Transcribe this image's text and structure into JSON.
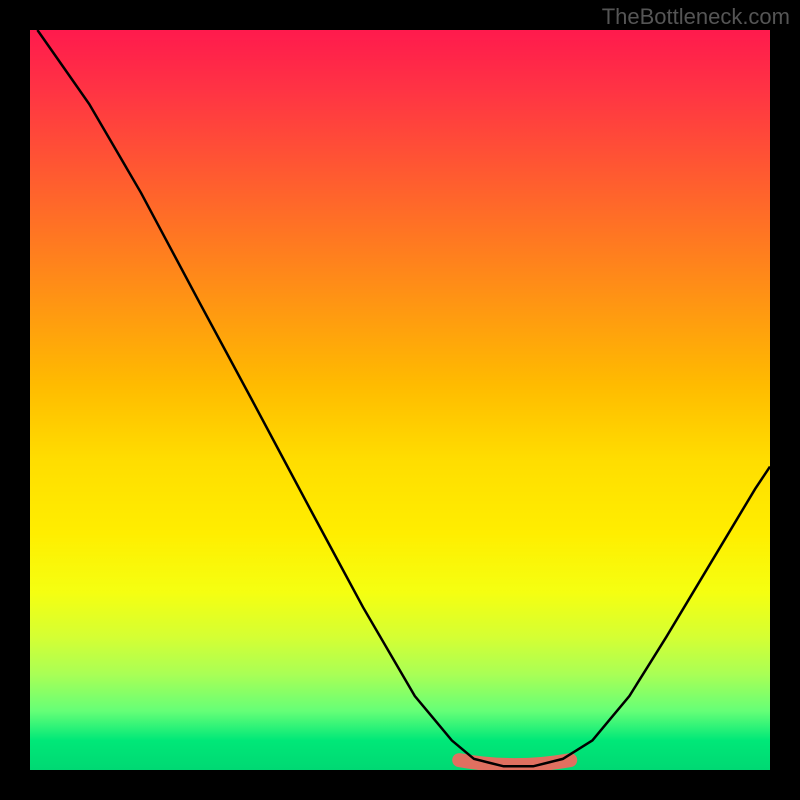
{
  "watermark": "TheBottleneck.com",
  "chart_data": {
    "type": "line",
    "title": "",
    "xlabel": "",
    "ylabel": "",
    "xlim": [
      0,
      100
    ],
    "ylim": [
      0,
      100
    ],
    "curve_points": [
      {
        "x": 1,
        "y": 100
      },
      {
        "x": 8,
        "y": 90
      },
      {
        "x": 15,
        "y": 78
      },
      {
        "x": 23,
        "y": 63
      },
      {
        "x": 30,
        "y": 50
      },
      {
        "x": 38,
        "y": 35
      },
      {
        "x": 45,
        "y": 22
      },
      {
        "x": 52,
        "y": 10
      },
      {
        "x": 57,
        "y": 4
      },
      {
        "x": 60,
        "y": 1.5
      },
      {
        "x": 64,
        "y": 0.5
      },
      {
        "x": 68,
        "y": 0.5
      },
      {
        "x": 72,
        "y": 1.5
      },
      {
        "x": 76,
        "y": 4
      },
      {
        "x": 81,
        "y": 10
      },
      {
        "x": 86,
        "y": 18
      },
      {
        "x": 92,
        "y": 28
      },
      {
        "x": 98,
        "y": 38
      },
      {
        "x": 100,
        "y": 41
      }
    ],
    "highlight_range": {
      "x_start": 58,
      "x_end": 73,
      "y": 0.8
    },
    "background_gradient": {
      "type": "vertical",
      "stops": [
        {
          "pos": 0,
          "color": "#ff1a4d"
        },
        {
          "pos": 50,
          "color": "#ffcc00"
        },
        {
          "pos": 100,
          "color": "#00d873"
        }
      ]
    }
  }
}
